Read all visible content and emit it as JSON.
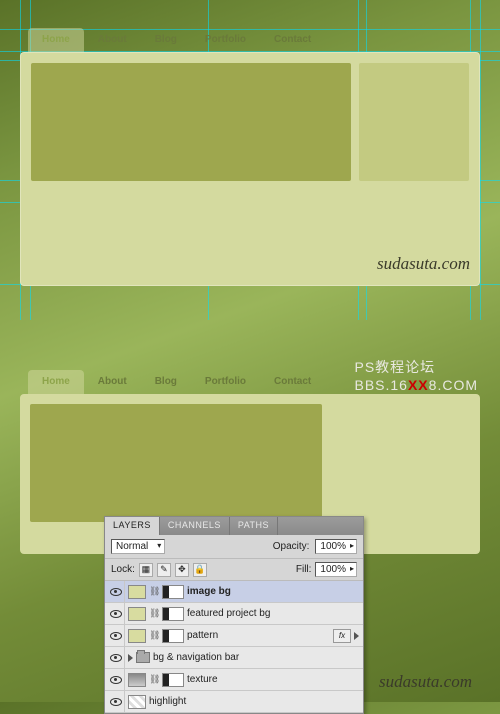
{
  "nav": {
    "items": [
      "Home",
      "About",
      "Blog",
      "Portfolio",
      "Contact"
    ],
    "active_index": 0
  },
  "watermark": "sudasuta.com",
  "forum": {
    "line1": "PS教程论坛",
    "line2_a": "BBS.16",
    "line2_b": "XX",
    "line2_c": "8.COM"
  },
  "layers_panel": {
    "tabs": [
      "LAYERS",
      "CHANNELS",
      "PATHS"
    ],
    "active_tab": 0,
    "blend_mode": "Normal",
    "opacity_label": "Opacity:",
    "opacity_value": "100%",
    "lock_label": "Lock:",
    "fill_label": "Fill:",
    "fill_value": "100%",
    "fx_label": "fx",
    "rows": [
      {
        "name": "image bg",
        "selected": true,
        "bold": true
      },
      {
        "name": "featured project bg"
      },
      {
        "name": "pattern",
        "fx": true
      },
      {
        "name": "bg & navigation bar",
        "is_group": true
      },
      {
        "name": "texture",
        "tex": true
      },
      {
        "name": "highlight",
        "hl": true
      }
    ]
  }
}
